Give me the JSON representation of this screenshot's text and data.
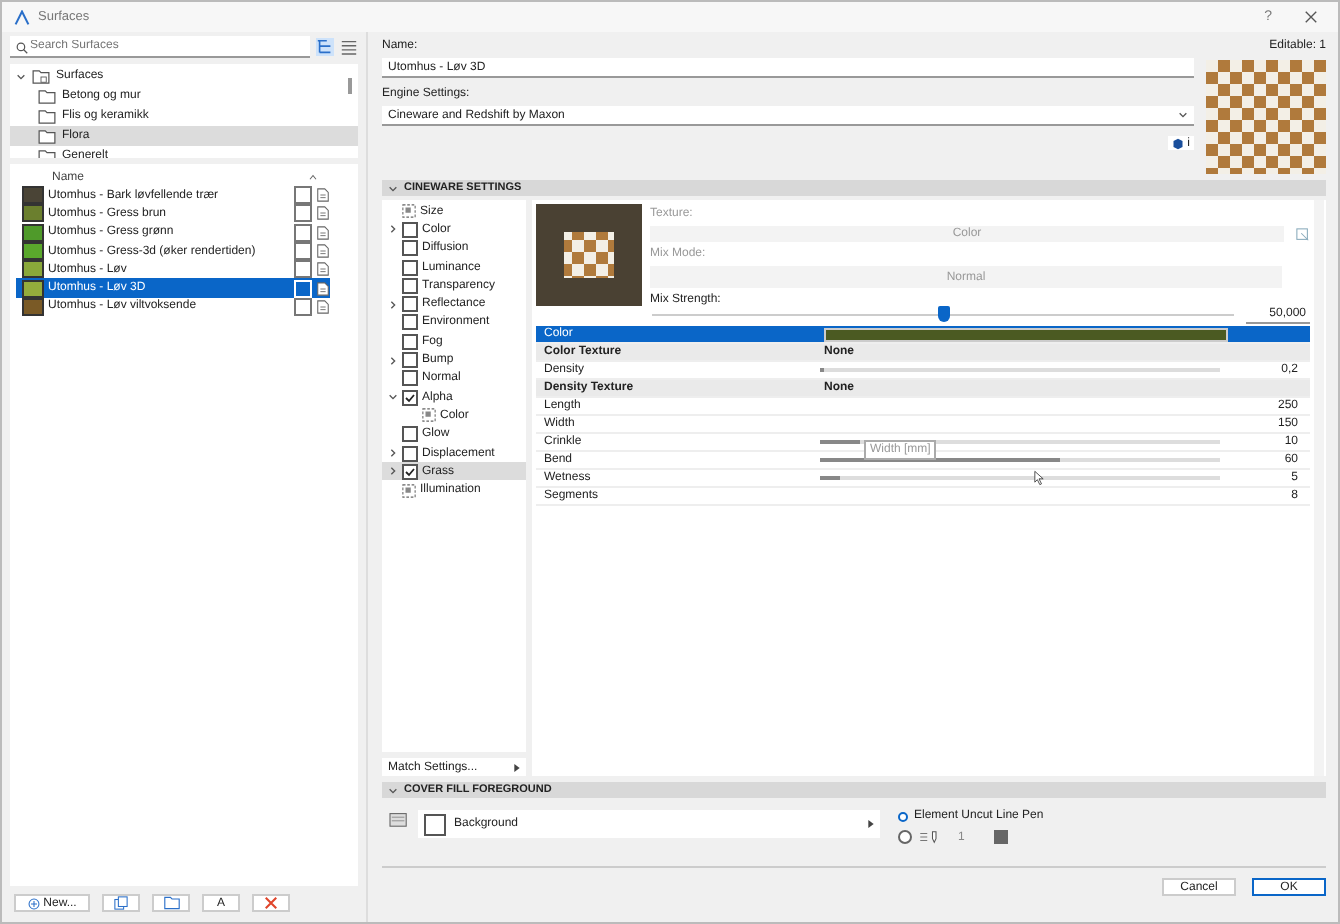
{
  "window": {
    "title": "Surfaces",
    "help": "?"
  },
  "library": {
    "search": {
      "placeholder": "Search Surfaces"
    },
    "tree": {
      "label": "Surfaces",
      "expanded": true,
      "children": [
        {
          "label": "Betong og mur",
          "selected": false
        },
        {
          "label": "Flis og keramikk",
          "selected": false
        },
        {
          "label": "Flora",
          "selected": true
        },
        {
          "label": "Generelt",
          "selected": false
        }
      ]
    },
    "list_header": "Name",
    "items": [
      {
        "name": "Utomhus - Bark løvfellende trær",
        "color": "#4a4436",
        "checked": false,
        "selected": false
      },
      {
        "name": "Utomhus - Gress brun",
        "color": "#6b7f2e",
        "checked": false,
        "selected": false
      },
      {
        "name": "Utomhus - Gress grønn",
        "color": "#4f9a2a",
        "checked": false,
        "selected": false
      },
      {
        "name": "Utomhus - Gress-3d (øker rendertiden)",
        "color": "#5aa82c",
        "checked": false,
        "selected": false
      },
      {
        "name": "Utomhus - Løv",
        "color": "#8aa83a",
        "checked": false,
        "selected": false
      },
      {
        "name": "Utomhus - Løv 3D",
        "color": "#94ac3c",
        "checked": false,
        "selected": true
      },
      {
        "name": "Utomhus - Løv viltvoksende",
        "color": "#7a5a26",
        "checked": false,
        "selected": false
      }
    ],
    "buttons": [
      {
        "kind": "new",
        "label": "New..."
      },
      {
        "kind": "duplicate"
      },
      {
        "kind": "folder"
      },
      {
        "kind": "rename",
        "label": "A"
      },
      {
        "kind": "delete"
      }
    ]
  },
  "details": {
    "name_label": "Name:",
    "editable": "Editable: 1",
    "name": "Utomhus - Løv 3D",
    "engine_label": "Engine Settings:",
    "engine": "Cineware and Redshift by Maxon",
    "badge": "i",
    "cineware": {
      "title": "CINEWARE SETTINGS",
      "expanded": true,
      "channels": [
        {
          "label": "Size",
          "kind": "icon",
          "expandable": false,
          "selected": false
        },
        {
          "label": "Color",
          "kind": "checkbox",
          "checked": false,
          "expandable": true,
          "expanded": false,
          "selected": false
        },
        {
          "label": "Diffusion",
          "kind": "checkbox",
          "checked": false,
          "expandable": false,
          "selected": false
        },
        {
          "label": "Luminance",
          "kind": "checkbox",
          "checked": false,
          "expandable": false,
          "selected": false
        },
        {
          "label": "Transparency",
          "kind": "checkbox",
          "checked": false,
          "expandable": false,
          "selected": false
        },
        {
          "label": "Reflectance",
          "kind": "checkbox",
          "checked": false,
          "expandable": true,
          "expanded": false,
          "selected": false
        },
        {
          "label": "Environment",
          "kind": "checkbox",
          "checked": false,
          "expandable": false,
          "selected": false
        },
        {
          "label": "Fog",
          "kind": "checkbox",
          "checked": false,
          "expandable": false,
          "selected": false
        },
        {
          "label": "Bump",
          "kind": "checkbox",
          "checked": false,
          "expandable": true,
          "expanded": false,
          "selected": false
        },
        {
          "label": "Normal",
          "kind": "checkbox",
          "checked": false,
          "expandable": false,
          "selected": false
        },
        {
          "label": "Alpha",
          "kind": "checkbox",
          "checked": true,
          "expandable": true,
          "expanded": true,
          "selected": false,
          "children": [
            {
              "label": "Color",
              "kind": "icon",
              "expandable": false,
              "selected": false
            }
          ]
        },
        {
          "label": "Glow",
          "kind": "checkbox",
          "checked": false,
          "expandable": false,
          "selected": false
        },
        {
          "label": "Displacement",
          "kind": "checkbox",
          "checked": false,
          "expandable": true,
          "expanded": false,
          "selected": false
        },
        {
          "label": "Grass",
          "kind": "checkbox",
          "checked": true,
          "expandable": true,
          "expanded": false,
          "selected": true
        },
        {
          "label": "Illumination",
          "kind": "icon",
          "expandable": false,
          "selected": false
        }
      ],
      "texture_label": "Texture:",
      "texture": "Color",
      "mix_mode_label": "Mix Mode:",
      "mix_mode": "Normal",
      "mix_strength_label": "Mix Strength:",
      "mix_strength": {
        "level": 0.5,
        "reading": "50,000"
      },
      "params": [
        {
          "kind": "color",
          "label": "Color",
          "color": "#4b5a22",
          "selected": true
        },
        {
          "kind": "header",
          "label": "Color Texture",
          "value": "None"
        },
        {
          "kind": "slider",
          "label": "Density",
          "level": 0.01,
          "reading": "0,2"
        },
        {
          "kind": "header",
          "label": "Density Texture",
          "value": "None"
        },
        {
          "kind": "number",
          "label": "Length",
          "reading": "250"
        },
        {
          "kind": "number",
          "label": "Width",
          "reading": "150"
        },
        {
          "kind": "slider",
          "label": "Crinkle",
          "level": 0.1,
          "reading": "10"
        },
        {
          "kind": "slider",
          "label": "Bend",
          "level": 0.6,
          "reading": "60"
        },
        {
          "kind": "slider",
          "label": "Wetness",
          "level": 0.05,
          "reading": "5"
        },
        {
          "kind": "number",
          "label": "Segments",
          "reading": "8"
        }
      ],
      "tooltip": "Width [mm]",
      "match_settings": "Match Settings..."
    },
    "cover_fill": {
      "title": "COVER FILL FOREGROUND",
      "expanded": true,
      "fill": "Background",
      "pens": [
        {
          "kind": "label",
          "label": "Element Uncut Line Pen",
          "selected": true
        },
        {
          "kind": "pen",
          "value": "1",
          "selected": false
        }
      ]
    }
  },
  "buttons": [
    {
      "label": "Cancel",
      "default": false
    },
    {
      "label": "OK",
      "default": true
    }
  ]
}
